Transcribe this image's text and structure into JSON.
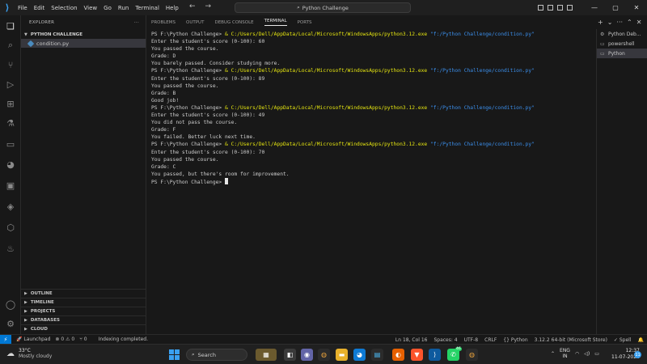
{
  "titlebar": {
    "menu": [
      "File",
      "Edit",
      "Selection",
      "View",
      "Go",
      "Run",
      "Terminal",
      "Help"
    ],
    "search": "Python Challenge"
  },
  "sidebar": {
    "title": "EXPLORER",
    "folder": "PYTHON CHALLENGE",
    "file": "condition.py",
    "sections": [
      "OUTLINE",
      "TIMELINE",
      "PROJECTS",
      "DATABASES",
      "CLOUD"
    ]
  },
  "panel": {
    "tabs": [
      "PROBLEMS",
      "OUTPUT",
      "DEBUG CONSOLE",
      "TERMINAL",
      "PORTS"
    ],
    "active_tab": "TERMINAL",
    "prompt": "PS F:\\Python Challenge>",
    "exe": "C:/Users/Dell/AppData/Local/Microsoft/WindowsApps/python3.12.exe",
    "script": "\"f:/Python Challenge/condition.py\"",
    "runs": [
      {
        "score_line": "Enter the student's score (0-100): 60",
        "pass_line": "You passed the course.",
        "grade": "Grade: D",
        "extra": "",
        "message": "You barely passed. Consider studying more."
      },
      {
        "score_line": "Enter the student's score (0-100): 89",
        "pass_line": "You passed the course.",
        "grade": "Grade: B",
        "extra": "",
        "message": "Good job!"
      },
      {
        "score_line": "Enter the student's score (0-100): 49",
        "pass_line": "You did not pass the course.",
        "grade": "Grade: F",
        "extra": "",
        "message": "You failed. Better luck next time."
      },
      {
        "score_line": "Enter the student's score (0-100): 70",
        "pass_line": "You passed the course.",
        "grade": "Grade: C",
        "extra": "",
        "message": "You passed, but there's room for improvement."
      }
    ],
    "final_prompt": "PS F:\\Python Challenge>"
  },
  "terminal_list": {
    "items": [
      "Python Deb...",
      "powershell",
      "Python"
    ],
    "active_index": 2
  },
  "statusbar": {
    "launchpad": "Launchpad",
    "errors": "0",
    "warnings": "0",
    "ports": "0",
    "indexing": "Indexing completed.",
    "position": "Ln 18, Col 16",
    "spaces": "Spaces: 4",
    "encoding": "UTF-8",
    "eol": "CRLF",
    "language": "Python",
    "interpreter": "3.12.2 64-bit (Microsoft Store)",
    "spell": "Spell"
  },
  "taskbar": {
    "temp": "33°C",
    "weather": "Mostly cloudy",
    "search": "Search",
    "whatsapp_badge": "46",
    "lang1": "ENG",
    "lang2": "IN",
    "time": "12:37",
    "date": "11-07-2024",
    "notifications": "11"
  }
}
